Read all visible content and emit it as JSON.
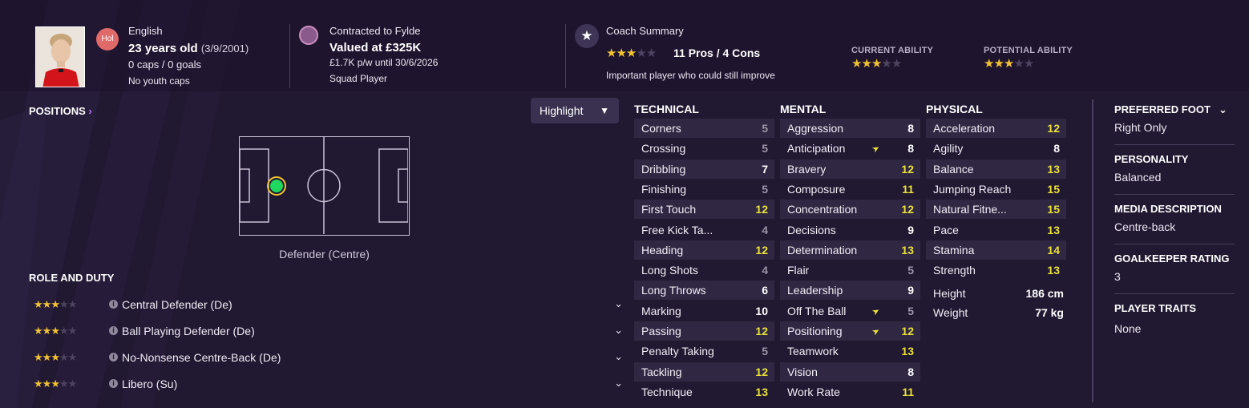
{
  "player": {
    "nationality": "English",
    "nation_code": "Hol",
    "age_line": "23 years old",
    "dob": "(3/9/2001)",
    "caps_line": "0 caps / 0 goals",
    "youth_caps": "No youth caps"
  },
  "contract": {
    "club_line": "Contracted to Fylde",
    "value_line": "Valued at £325K",
    "wage_line": "£1.7K p/w until 30/6/2026",
    "squad_status": "Squad Player"
  },
  "coach": {
    "title": "Coach Summary",
    "stars": 3,
    "pros_cons": "11 Pros / 4 Cons",
    "summary": "Important player who could still improve",
    "current_ability_label": "CURRENT ABILITY",
    "current_ability_stars": 3,
    "potential_ability_label": "POTENTIAL ABILITY",
    "potential_ability_stars": 3
  },
  "positions": {
    "title": "POSITIONS",
    "highlight_label": "Highlight",
    "position_label": "Defender (Centre)"
  },
  "roles": {
    "title": "ROLE AND DUTY",
    "items": [
      {
        "name": "Central Defender (De)",
        "stars": 3
      },
      {
        "name": "Ball Playing Defender (De)",
        "stars": 3
      },
      {
        "name": "No-Nonsense Centre-Back (De)",
        "stars": 3
      },
      {
        "name": "Libero (Su)",
        "stars": 3
      }
    ]
  },
  "attributes": {
    "technical": {
      "title": "TECHNICAL",
      "items": [
        {
          "name": "Corners",
          "value": "5"
        },
        {
          "name": "Crossing",
          "value": "5"
        },
        {
          "name": "Dribbling",
          "value": "7"
        },
        {
          "name": "Finishing",
          "value": "5"
        },
        {
          "name": "First Touch",
          "value": "12"
        },
        {
          "name": "Free Kick Ta...",
          "value": "4"
        },
        {
          "name": "Heading",
          "value": "12"
        },
        {
          "name": "Long Shots",
          "value": "4"
        },
        {
          "name": "Long Throws",
          "value": "6"
        },
        {
          "name": "Marking",
          "value": "10"
        },
        {
          "name": "Passing",
          "value": "12"
        },
        {
          "name": "Penalty Taking",
          "value": "5"
        },
        {
          "name": "Tackling",
          "value": "12"
        },
        {
          "name": "Technique",
          "value": "13"
        }
      ]
    },
    "mental": {
      "title": "MENTAL",
      "items": [
        {
          "name": "Aggression",
          "value": "8"
        },
        {
          "name": "Anticipation",
          "value": "8",
          "trend": true
        },
        {
          "name": "Bravery",
          "value": "12"
        },
        {
          "name": "Composure",
          "value": "11"
        },
        {
          "name": "Concentration",
          "value": "12"
        },
        {
          "name": "Decisions",
          "value": "9"
        },
        {
          "name": "Determination",
          "value": "13"
        },
        {
          "name": "Flair",
          "value": "5"
        },
        {
          "name": "Leadership",
          "value": "9"
        },
        {
          "name": "Off The Ball",
          "value": "5",
          "trend": true
        },
        {
          "name": "Positioning",
          "value": "12",
          "trend": true
        },
        {
          "name": "Teamwork",
          "value": "13"
        },
        {
          "name": "Vision",
          "value": "8"
        },
        {
          "name": "Work Rate",
          "value": "11"
        }
      ]
    },
    "physical": {
      "title": "PHYSICAL",
      "items": [
        {
          "name": "Acceleration",
          "value": "12"
        },
        {
          "name": "Agility",
          "value": "8"
        },
        {
          "name": "Balance",
          "value": "13"
        },
        {
          "name": "Jumping Reach",
          "value": "15"
        },
        {
          "name": "Natural Fitne...",
          "value": "15"
        },
        {
          "name": "Pace",
          "value": "13"
        },
        {
          "name": "Stamina",
          "value": "14"
        },
        {
          "name": "Strength",
          "value": "13"
        }
      ],
      "height_label": "Height",
      "height_value": "186 cm",
      "weight_label": "Weight",
      "weight_value": "77 kg"
    }
  },
  "info_panel": {
    "preferred_foot_title": "PREFERRED FOOT",
    "preferred_foot": "Right Only",
    "personality_title": "PERSONALITY",
    "personality": "Balanced",
    "media_title": "MEDIA DESCRIPTION",
    "media": "Centre-back",
    "gk_rating_title": "GOALKEEPER RATING",
    "gk_rating": "3",
    "traits_title": "PLAYER TRAITS",
    "traits": "None"
  },
  "colors": {
    "background": "#211831",
    "star": "#f1c232",
    "good_value": "#e9e23a",
    "position_dot": "#1fd65f"
  }
}
